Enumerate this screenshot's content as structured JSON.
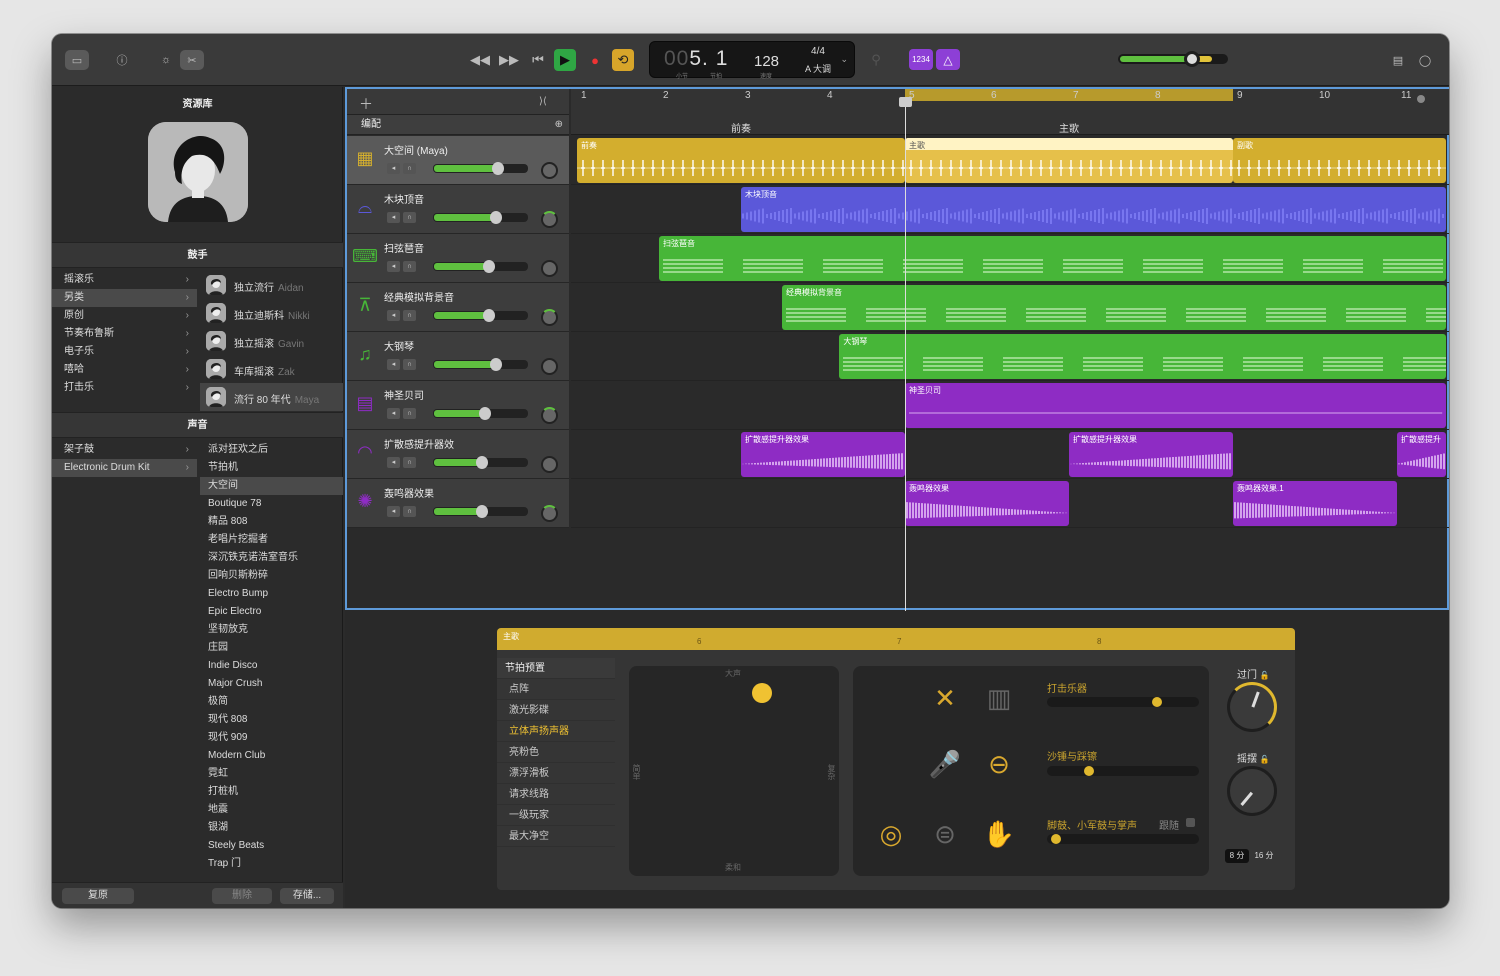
{
  "toolbar": {
    "lcd_position_dim": "00",
    "lcd_position": "5. 1",
    "lcd_bar_label": "小节",
    "lcd_beat_label": "节拍",
    "lcd_tempo": "128",
    "lcd_tempo_label": "速度",
    "lcd_signature": "4/4",
    "lcd_key": "A 大调",
    "count_in_label": "1234",
    "master_volume": 0.62
  },
  "library": {
    "title": "资源库",
    "drummer_section": "鼓手",
    "genres": [
      {
        "label": "摇滚乐"
      },
      {
        "label": "另类",
        "selected": true
      },
      {
        "label": "原创"
      },
      {
        "label": "节奏布鲁斯"
      },
      {
        "label": "电子乐"
      },
      {
        "label": "嘻哈"
      },
      {
        "label": "打击乐"
      }
    ],
    "drummers": [
      {
        "style": "独立流行",
        "name": "Aidan"
      },
      {
        "style": "独立迪斯科",
        "name": "Nikki"
      },
      {
        "style": "独立摇滚",
        "name": "Gavin"
      },
      {
        "style": "车库摇滚",
        "name": "Zak"
      },
      {
        "style": "流行 80 年代",
        "name": "Maya",
        "selected": true
      }
    ],
    "sound_section": "声音",
    "kit_categories": [
      {
        "label": "架子鼓"
      },
      {
        "label": "Electronic Drum Kit",
        "selected": true
      }
    ],
    "kits": [
      "派对狂欢之后",
      "节拍机",
      "大空间",
      "Boutique 78",
      "精品 808",
      "老唱片挖掘者",
      "深沉铁克诺浩室音乐",
      "回响贝斯粉碎",
      "Electro Bump",
      "Epic Electro",
      "坚韧放克",
      "庄园",
      "Indie Disco",
      "Major Crush",
      "极简",
      "现代 808",
      "现代 909",
      "Modern Club",
      "霓虹",
      "打桩机",
      "地震",
      "银湖",
      "Steely Beats",
      "Trap 门"
    ],
    "selected_kit_index": 2,
    "revert_label": "复原",
    "delete_label": "删除",
    "save_label": "存储..."
  },
  "tracks": {
    "arrangement_label": "编配",
    "bar_numbers": [
      "1",
      "2",
      "3",
      "4",
      "5",
      "6",
      "7",
      "8",
      "9",
      "10",
      "11"
    ],
    "sections": [
      {
        "label": "前奏"
      },
      {
        "label": "主歌"
      }
    ],
    "list": [
      {
        "name": "大空间 (Maya)",
        "icon": "drum-machine-icon",
        "color": "#d3ae2e",
        "volume": 0.7,
        "selected": true
      },
      {
        "name": "木块顶音",
        "icon": "synth-pad-icon",
        "color": "#5b58d9",
        "volume": 0.68
      },
      {
        "name": "扫弦琶音",
        "icon": "keyboard-icon",
        "color": "#47b638",
        "volume": 0.6
      },
      {
        "name": "经典模拟背景音",
        "icon": "synth-icon",
        "color": "#47b638",
        "volume": 0.6
      },
      {
        "name": "大钢琴",
        "icon": "piano-icon",
        "color": "#47b638",
        "volume": 0.68
      },
      {
        "name": "神圣贝司",
        "icon": "bass-synth-icon",
        "color": "#8e2cc4",
        "volume": 0.56
      },
      {
        "name": "扩散感提升器效",
        "icon": "riser-icon",
        "color": "#8e2cc4",
        "volume": 0.53
      },
      {
        "name": "轰鸣器效果",
        "icon": "fx-icon",
        "color": "#8e2cc4",
        "volume": 0.53
      }
    ],
    "regions": [
      [
        {
          "label": "前奏",
          "start": 1,
          "end": 5,
          "type": "y"
        },
        {
          "label": "主歌",
          "start": 5,
          "end": 9,
          "type": "y",
          "selected": true
        },
        {
          "label": "副歌",
          "start": 9,
          "end": 11.6,
          "type": "y"
        }
      ],
      [
        {
          "label": "木块顶音",
          "start": 3,
          "end": 11.6,
          "type": "b"
        }
      ],
      [
        {
          "label": "扫弦琶音",
          "start": 2,
          "end": 11.6,
          "type": "g"
        }
      ],
      [
        {
          "label": "经典模拟背景音",
          "start": 3.5,
          "end": 11.6,
          "type": "g"
        }
      ],
      [
        {
          "label": "大钢琴",
          "start": 4.2,
          "end": 11.6,
          "type": "g"
        }
      ],
      [
        {
          "label": "神圣贝司",
          "start": 5,
          "end": 11.6,
          "type": "p"
        }
      ],
      [
        {
          "label": "扩散感提升器效果",
          "start": 3,
          "end": 5,
          "type": "p"
        },
        {
          "label": "扩散感提升器效果",
          "start": 7,
          "end": 9,
          "type": "p"
        },
        {
          "label": "扩散感提升",
          "start": 11,
          "end": 11.6,
          "type": "p"
        }
      ],
      [
        {
          "label": "轰鸣器效果",
          "start": 5,
          "end": 7,
          "type": "p"
        },
        {
          "label": "轰鸣器效果.1",
          "start": 9,
          "end": 11,
          "type": "p"
        }
      ]
    ]
  },
  "editor": {
    "region_label": "主歌",
    "ruler_marks": [
      "6",
      "7",
      "8"
    ],
    "presets_header": "节拍预置",
    "presets": [
      "点阵",
      "激光影碟",
      "立体声扬声器",
      "亮粉色",
      "漂浮滑板",
      "请求线路",
      "一级玩家",
      "最大净空"
    ],
    "active_preset_index": 2,
    "xy_top": "大声",
    "xy_bottom": "柔和",
    "xy_left": "简单",
    "xy_right": "复杂",
    "percussion_label": "打击乐器",
    "percussion_value": 0.74,
    "shaker_label": "沙锤与踩镲",
    "shaker_value": 0.26,
    "kick_label": "脚鼓、小军鼓与掌声",
    "follow_label": "跟随",
    "kick_value": 0.03,
    "fill_label": "过门",
    "swing_label": "摇摆",
    "seg_8": "8 分",
    "seg_16": "16 分"
  }
}
